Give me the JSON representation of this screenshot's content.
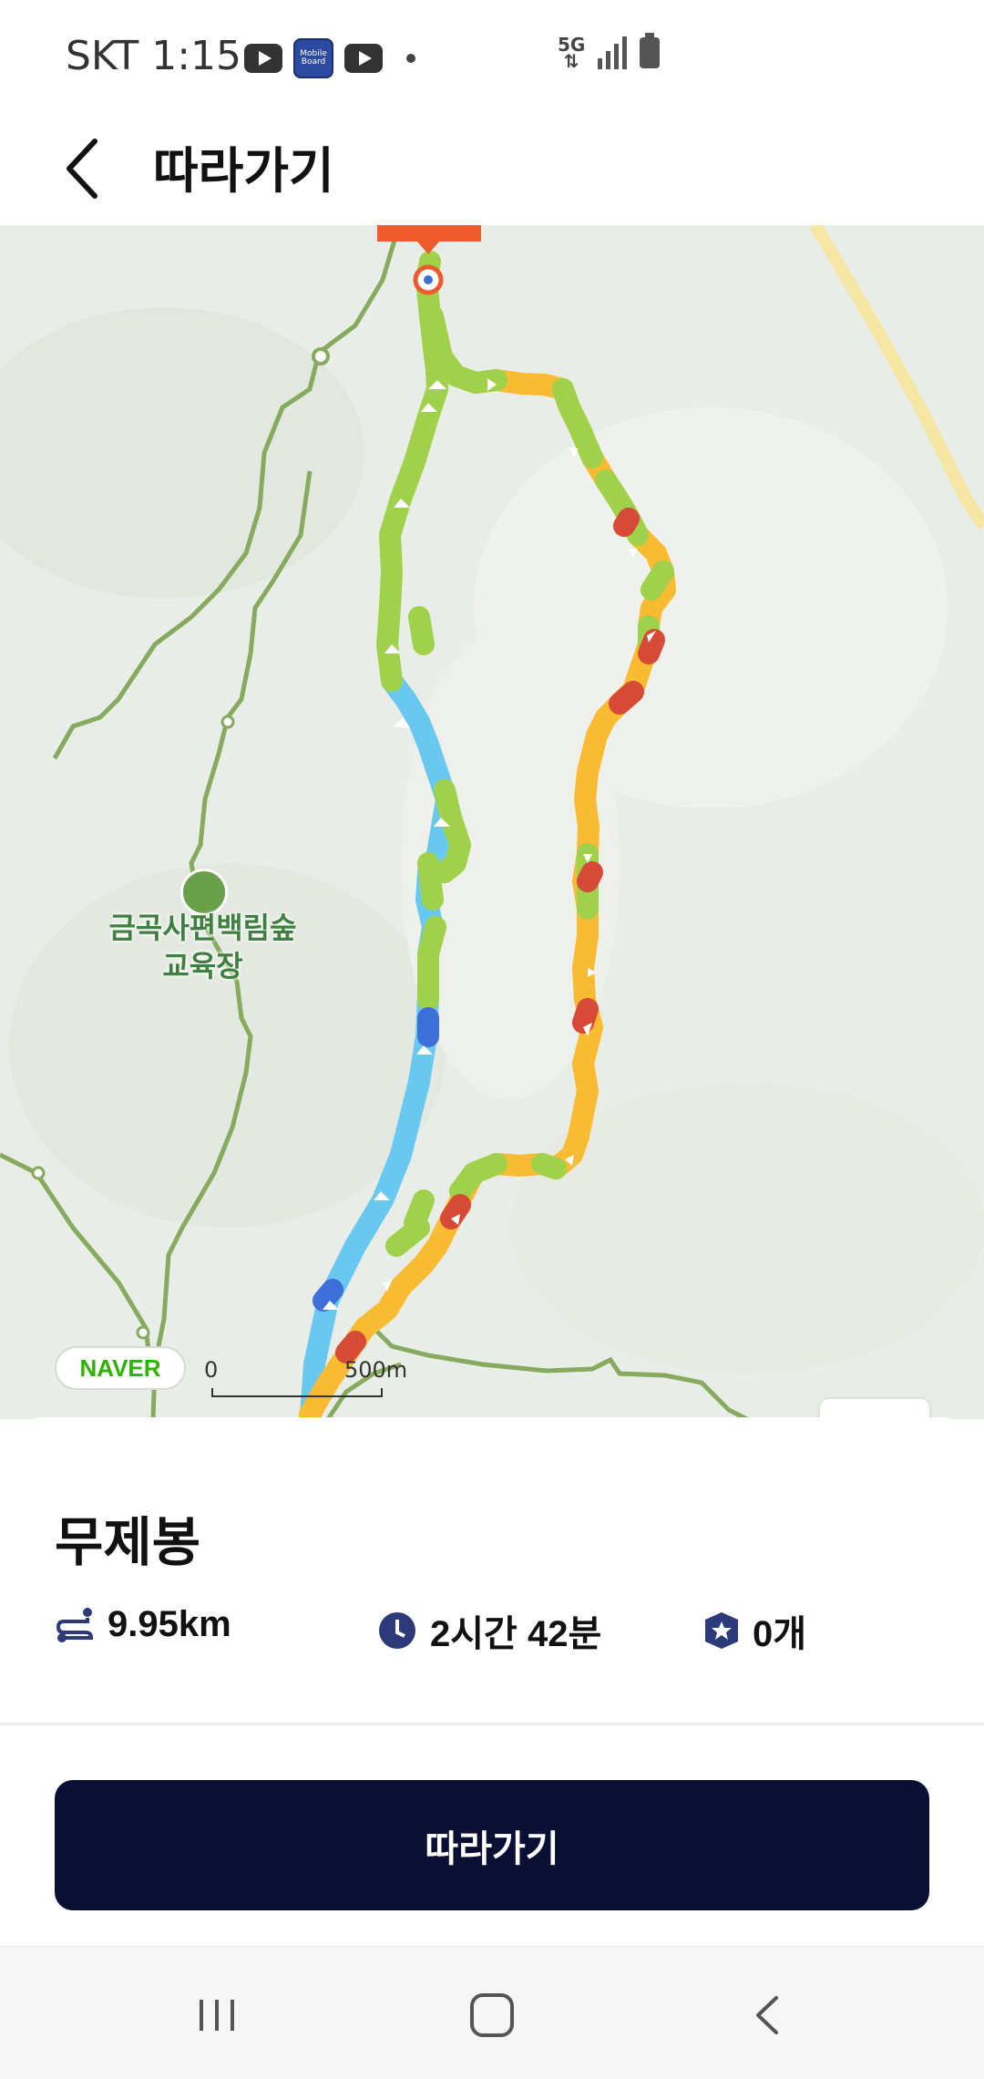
{
  "status_bar": {
    "carrier_time": "SKT 1:15",
    "network": "5G",
    "app_icons": [
      "youtube-icon",
      "mobile-board-icon",
      "youtube-icon"
    ],
    "mobile_board_text": "Mobile Board"
  },
  "header": {
    "title": "따라가기",
    "back_icon": "chevron-left-icon"
  },
  "map": {
    "provider": "NAVER",
    "scale_zero": "0",
    "scale_distance": "500m",
    "poi_name": "금곡사편백림숲\n교육장",
    "controls": [
      "elevation-icon",
      "reverse-direction-icon"
    ],
    "route_colors": {
      "green": "#9fd24a",
      "blue": "#69c8f0",
      "orange": "#f8bb31",
      "red": "#d64a37",
      "dark_blue": "#3e6fd8"
    }
  },
  "sheet": {
    "name": "무제봉",
    "distance": "9.95km",
    "duration": "2시간 42분",
    "count": "0개",
    "distance_icon": "route-icon",
    "duration_icon": "clock-icon",
    "count_icon": "badge-star-icon"
  },
  "cta": {
    "label": "따라가기"
  },
  "navigation": {
    "buttons": [
      "recent-apps-icon",
      "home-icon",
      "back-icon"
    ]
  }
}
